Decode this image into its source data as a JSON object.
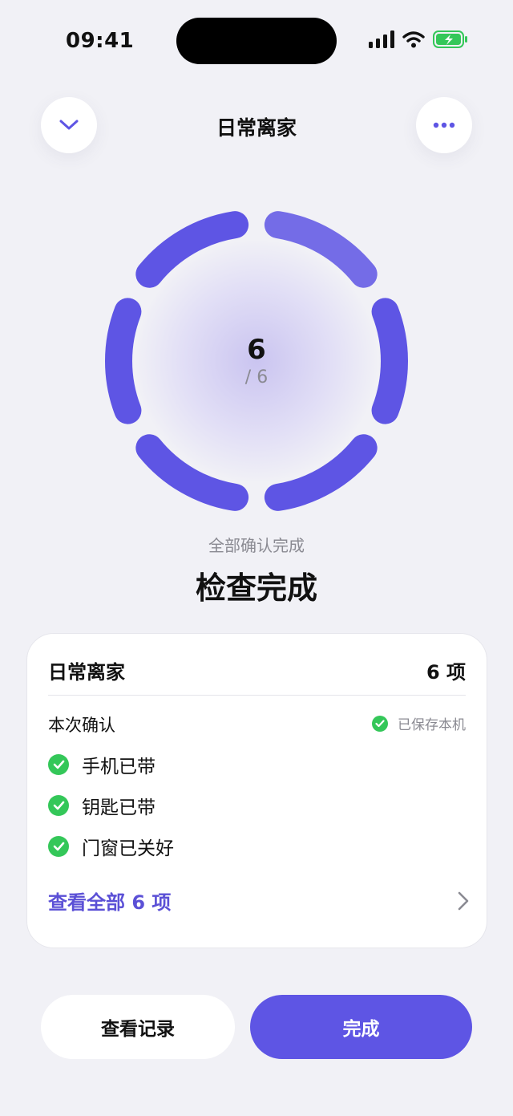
{
  "status_bar": {
    "time": "09:41"
  },
  "header": {
    "title": "日常离家"
  },
  "progress": {
    "done": "6",
    "total_label": "/ 6",
    "completed": 6,
    "total": 6,
    "ring_color": "#5E55E4"
  },
  "summary": {
    "subtitle": "全部确认完成",
    "title": "检查完成"
  },
  "card": {
    "title": "日常离家",
    "count": "6 项",
    "section_label": "本次确认",
    "saved_label": "已保存本机",
    "items": [
      {
        "label": "手机已带"
      },
      {
        "label": "钥匙已带"
      },
      {
        "label": "门窗已关好"
      }
    ],
    "view_all_label": "查看全部 6 项"
  },
  "buttons": {
    "history": "查看记录",
    "done": "完成"
  },
  "colors": {
    "accent": "#5E55E4",
    "success": "#34C759",
    "background": "#F1F1F6"
  }
}
